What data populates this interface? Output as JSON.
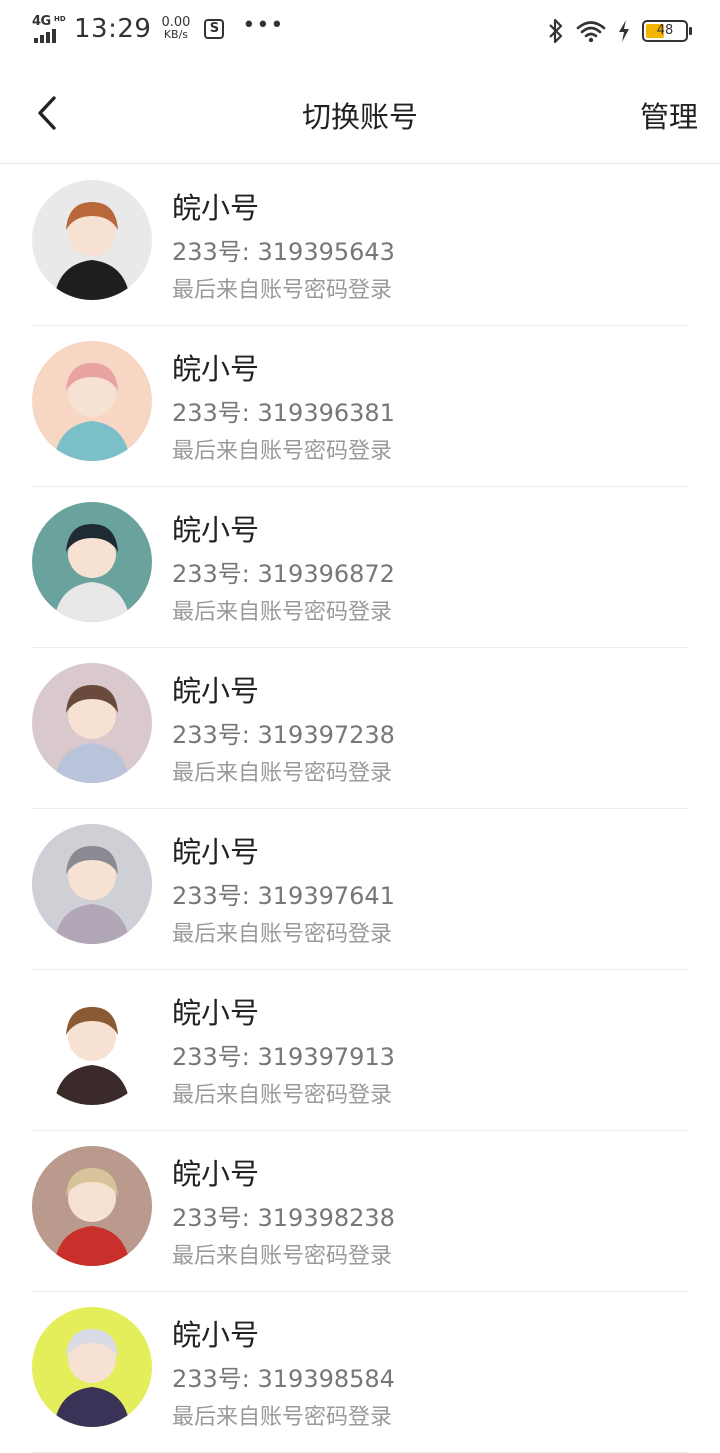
{
  "status_bar": {
    "network": "4G",
    "network_sub": "HD",
    "time": "13:29",
    "speed_value": "0.00",
    "speed_unit": "KB/s",
    "app_icon_label": "S",
    "more": "•••",
    "battery_level": "48",
    "battery_percent": 48,
    "icons": [
      "signal-icon",
      "bluetooth-icon",
      "wifi-icon",
      "charging-icon",
      "battery-icon"
    ]
  },
  "header": {
    "title": "切换账号",
    "manage_label": "管理",
    "back_icon": "chevron-left-icon"
  },
  "accounts": [
    {
      "name": "皖小号",
      "id_text": "233号: 319395643",
      "login_text": "最后来自账号密码登录",
      "avatar_color": "#e9e9e9"
    },
    {
      "name": "皖小号",
      "id_text": "233号: 319396381",
      "login_text": "最后来自账号密码登录",
      "avatar_color": "#f7d6c4"
    },
    {
      "name": "皖小号",
      "id_text": "233号: 319396872",
      "login_text": "最后来自账号密码登录",
      "avatar_color": "#6aa39d"
    },
    {
      "name": "皖小号",
      "id_text": "233号: 319397238",
      "login_text": "最后来自账号密码登录",
      "avatar_color": "#d9c8cc"
    },
    {
      "name": "皖小号",
      "id_text": "233号: 319397641",
      "login_text": "最后来自账号密码登录",
      "avatar_color": "#cfcfd6"
    },
    {
      "name": "皖小号",
      "id_text": "233号: 319397913",
      "login_text": "最后来自账号密码登录",
      "avatar_color": "#ffffff"
    },
    {
      "name": "皖小号",
      "id_text": "233号: 319398238",
      "login_text": "最后来自账号密码登录",
      "avatar_color": "#b99a8c"
    },
    {
      "name": "皖小号",
      "id_text": "233号: 319398584",
      "login_text": "最后来自账号密码登录",
      "avatar_color": "#e3ee5a"
    }
  ]
}
